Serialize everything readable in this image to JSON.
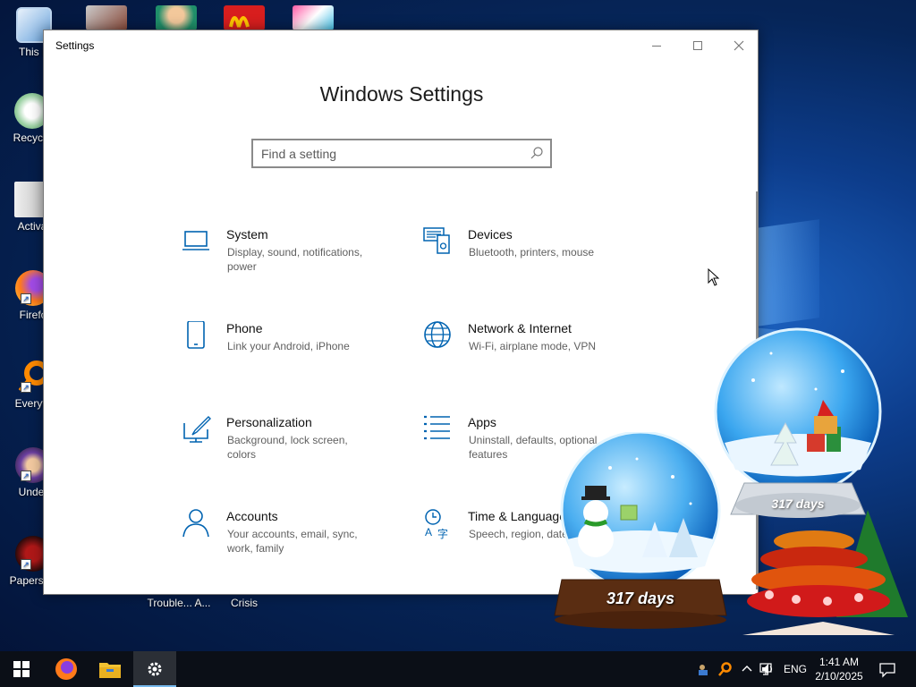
{
  "desktop": {
    "icons": [
      {
        "label": "This P"
      },
      {
        "label": "Recycle"
      },
      {
        "label": "Activa"
      },
      {
        "label": "Firefo"
      },
      {
        "label": "Everyth"
      },
      {
        "label": "Under"
      },
      {
        "label": "Papers, P"
      }
    ],
    "bottom_labels": [
      "Trouble... A...",
      "Crisis"
    ]
  },
  "window": {
    "title": "Settings",
    "heading": "Windows Settings",
    "search_placeholder": "Find a setting"
  },
  "categories": [
    {
      "title": "System",
      "desc": "Display, sound, notifications, power",
      "icon": "laptop-icon"
    },
    {
      "title": "Devices",
      "desc": "Bluetooth, printers, mouse",
      "icon": "devices-icon"
    },
    {
      "title": "Phone",
      "desc": "Link your Android, iPhone",
      "icon": "phone-icon"
    },
    {
      "title": "Network & Internet",
      "desc": "Wi-Fi, airplane mode, VPN",
      "icon": "globe-icon"
    },
    {
      "title": "Personalization",
      "desc": "Background, lock screen, colors",
      "icon": "brush-icon"
    },
    {
      "title": "Apps",
      "desc": "Uninstall, defaults, optional features",
      "icon": "apps-list-icon"
    },
    {
      "title": "Accounts",
      "desc": "Your accounts, email, sync, work, family",
      "icon": "person-icon"
    },
    {
      "title": "Time & Language",
      "desc": "Speech, region, date",
      "icon": "time-language-icon"
    }
  ],
  "gadgets": {
    "globe_small_counter": "317 days",
    "globe_large_counter": "317 days"
  },
  "taskbar": {
    "language": "ENG",
    "time": "1:41 AM",
    "date": "2/10/2025"
  },
  "colors": {
    "accent": "#0063b1",
    "taskbar": "#0b0f17"
  }
}
